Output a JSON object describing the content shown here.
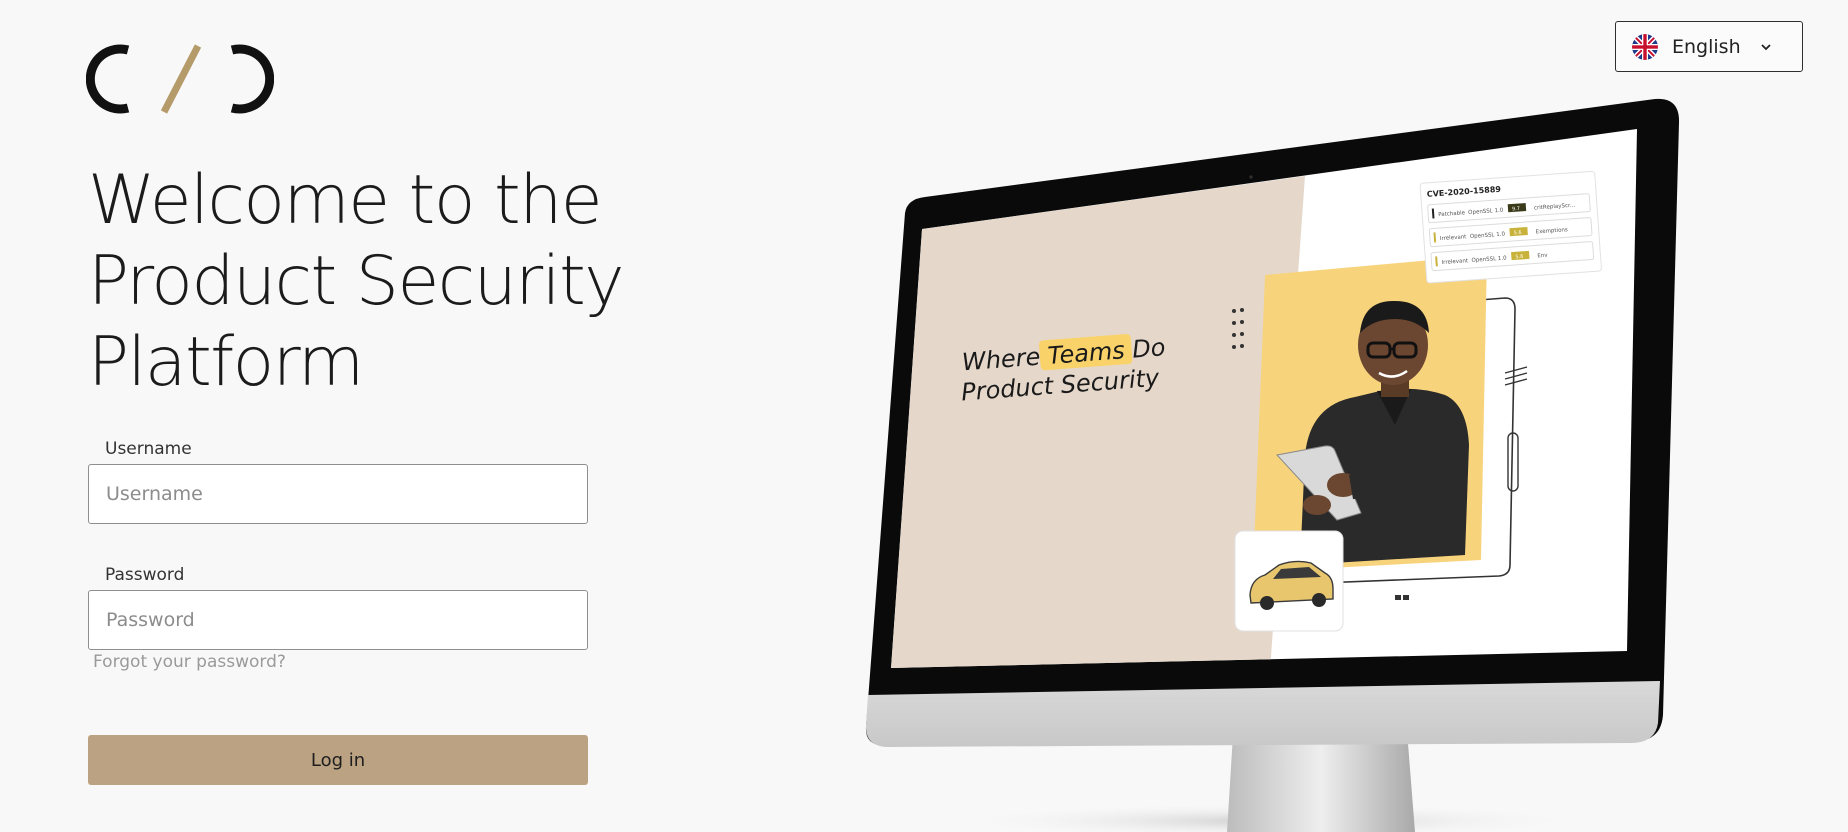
{
  "heading": {
    "line1": "Welcome to the",
    "line2": "Product Security",
    "line3": "Platform"
  },
  "form": {
    "username_label": "Username",
    "username_placeholder": "Username",
    "username_value": "",
    "password_label": "Password",
    "password_placeholder": "Password",
    "password_value": "",
    "forgot_link": "Forgot your password?",
    "login_label": "Log in"
  },
  "language": {
    "selected": "English",
    "flag_icon": "uk-flag-icon",
    "chevron_icon": "chevron-down-icon"
  },
  "illustration": {
    "tagline_line1_prefix": "Where ",
    "tagline_highlight": "Teams",
    "tagline_line1_suffix": " Do",
    "tagline_line2": "Product Security",
    "cve_id": "CVE-2020-15889",
    "table_rows": [
      {
        "status": "Patchable",
        "component": "OpenSSL 1.0",
        "badge": "9.7",
        "note": "critReplayScr..."
      },
      {
        "status": "Irrelevant",
        "component": "OpenSSL 1.0",
        "badge": "5.6",
        "note": "Exemptions"
      },
      {
        "status": "Irrelevant",
        "component": "OpenSSL 1.0",
        "badge": "5.6",
        "note": "Env"
      }
    ]
  },
  "colors": {
    "background": "#f8f8f8",
    "accent_gold": "#bba282",
    "logo_slash": "#b59a6a",
    "screen_beige": "#e5d8cb",
    "photo_yellow": "#f7d37c",
    "highlight": "#f9d36a"
  }
}
